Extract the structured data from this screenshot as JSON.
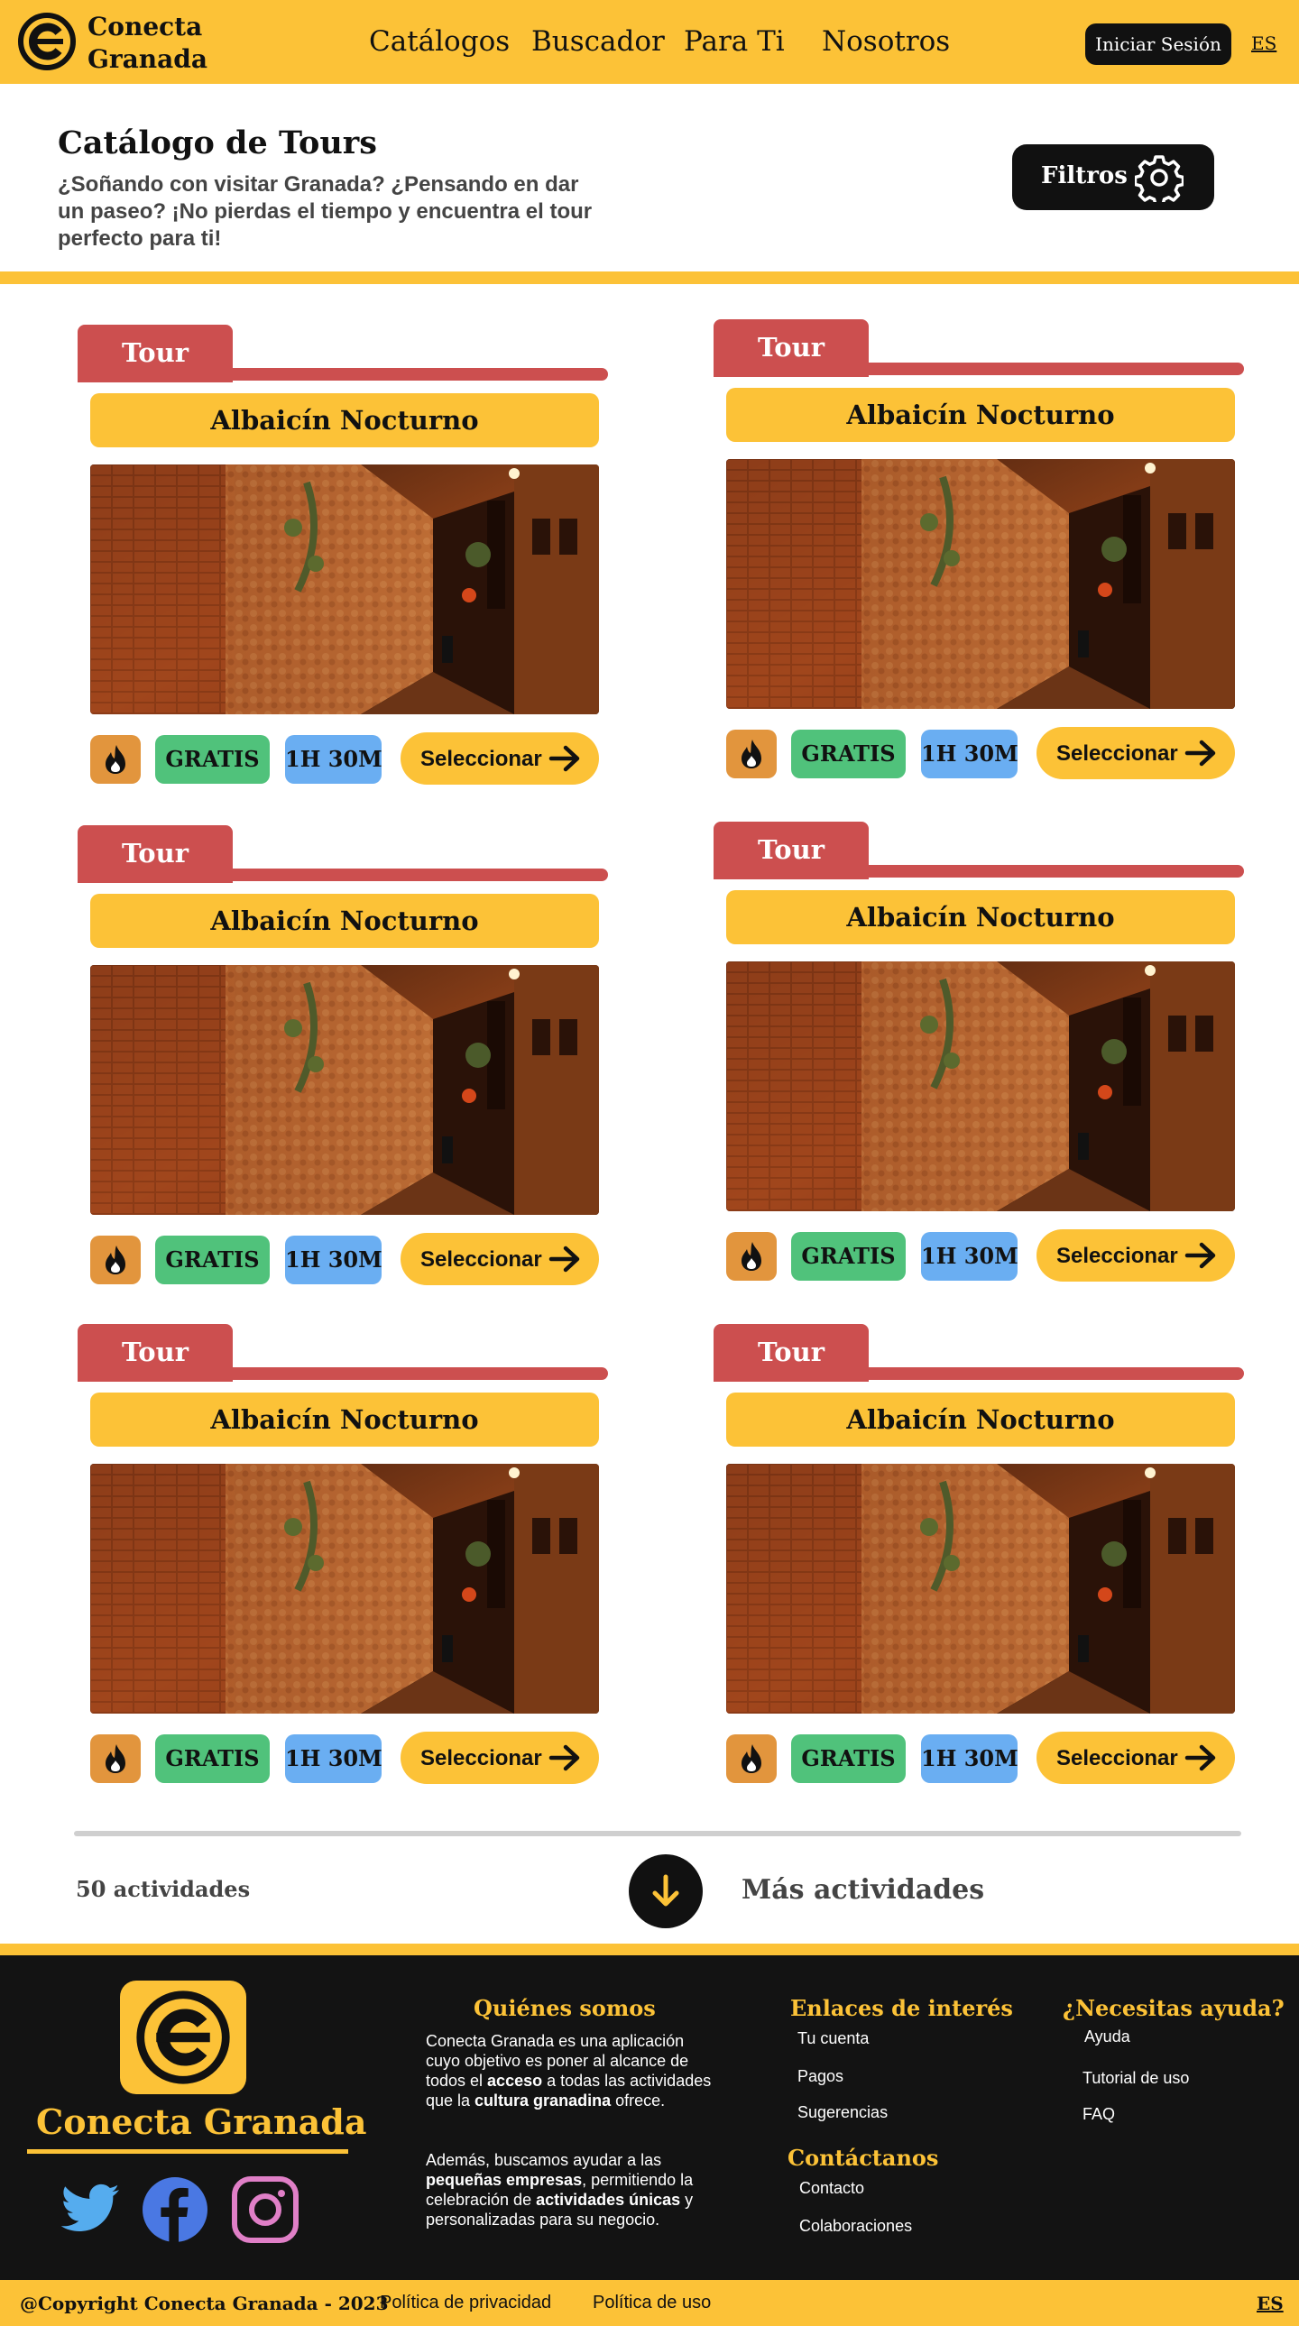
{
  "header": {
    "brand_line1": "Conecta",
    "brand_line2": "Granada",
    "nav": [
      "Catálogos",
      "Buscador",
      "Para Ti",
      "Nosotros"
    ],
    "login_label": "Iniciar Sesión",
    "language": "ES"
  },
  "intro": {
    "title": "Catálogo de Tours",
    "description": "¿Soñando con visitar Granada? ¿Pensando en dar un paseo? ¡No pierdas el tiempo y encuentra el tour perfecto para ti!",
    "filters_label": "Filtros"
  },
  "cards": [
    {
      "tag": "Tour",
      "title": "Albaicín Nocturno",
      "price": "GRATIS",
      "duration": "1H 30M",
      "select_label": "Seleccionar"
    },
    {
      "tag": "Tour",
      "title": "Albaicín Nocturno",
      "price": "GRATIS",
      "duration": "1H 30M",
      "select_label": "Seleccionar"
    },
    {
      "tag": "Tour",
      "title": "Albaicín Nocturno",
      "price": "GRATIS",
      "duration": "1H 30M",
      "select_label": "Seleccionar"
    },
    {
      "tag": "Tour",
      "title": "Albaicín Nocturno",
      "price": "GRATIS",
      "duration": "1H 30M",
      "select_label": "Seleccionar"
    },
    {
      "tag": "Tour",
      "title": "Albaicín Nocturno",
      "price": "GRATIS",
      "duration": "1H 30M",
      "select_label": "Seleccionar"
    },
    {
      "tag": "Tour",
      "title": "Albaicín Nocturno",
      "price": "GRATIS",
      "duration": "1H 30M",
      "select_label": "Seleccionar"
    }
  ],
  "pagination": {
    "count": "50 actividades",
    "more_label": "Más actividades"
  },
  "footer": {
    "brand": "Conecta Granada",
    "about": {
      "heading": "Quiénes somos",
      "p1_a": "Conecta Granada es una aplicación cuyo objetivo es poner al alcance de todos el ",
      "p1_b": "acceso",
      "p1_c": " a todas las actividades que la ",
      "p1_d": "cultura granadina",
      "p1_e": " ofrece.",
      "p2_a": "Además, buscamos ayudar a las ",
      "p2_b": "pequeñas empresas",
      "p2_c": ", permitiendo la celebración de ",
      "p2_d": "actividades únicas",
      "p2_e": " y personalizadas para su negocio."
    },
    "links": {
      "heading": "Enlaces de interés",
      "items": [
        "Tu cuenta",
        "Pagos",
        "Sugerencias"
      ]
    },
    "contact": {
      "heading": "Contáctanos",
      "items": [
        "Contacto",
        "Colaboraciones"
      ]
    },
    "help": {
      "heading": "¿Necesitas ayuda?",
      "items": [
        "Ayuda",
        "Tutorial de uso",
        "FAQ"
      ]
    },
    "social": [
      "twitter-icon",
      "facebook-icon",
      "instagram-icon"
    ]
  },
  "bottom": {
    "copyright": "@Copyright Conecta Granada - 2023",
    "privacy": "Política de privacidad",
    "usage": "Política de uso",
    "language": "ES"
  },
  "colors": {
    "brand_yellow": "#fcc237",
    "tag_red": "#cc4f4f",
    "price_green": "#50c27b",
    "duration_blue": "#6aaef2",
    "fire_orange": "#e2953d",
    "dark": "#131313"
  }
}
